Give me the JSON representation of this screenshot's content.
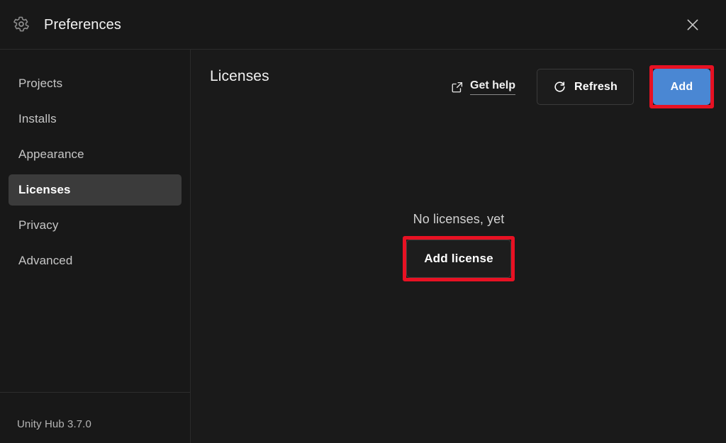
{
  "window": {
    "title": "Preferences",
    "gear_icon": "gear-icon",
    "close_icon": "close-icon"
  },
  "sidebar": {
    "items": [
      {
        "label": "Projects",
        "selected": false
      },
      {
        "label": "Installs",
        "selected": false
      },
      {
        "label": "Appearance",
        "selected": false
      },
      {
        "label": "Licenses",
        "selected": true
      },
      {
        "label": "Privacy",
        "selected": false
      },
      {
        "label": "Advanced",
        "selected": false
      }
    ],
    "version": "Unity Hub 3.7.0"
  },
  "main": {
    "title": "Licenses",
    "get_help": {
      "label": "Get help",
      "icon": "external-link-icon"
    },
    "refresh": {
      "label": "Refresh",
      "icon": "refresh-icon"
    },
    "add": {
      "label": "Add",
      "highlight_color": "#e81123",
      "accent_color": "#4a87d3"
    },
    "empty_state": {
      "message": "No licenses, yet",
      "action_label": "Add license",
      "highlight_color": "#e81123"
    }
  }
}
